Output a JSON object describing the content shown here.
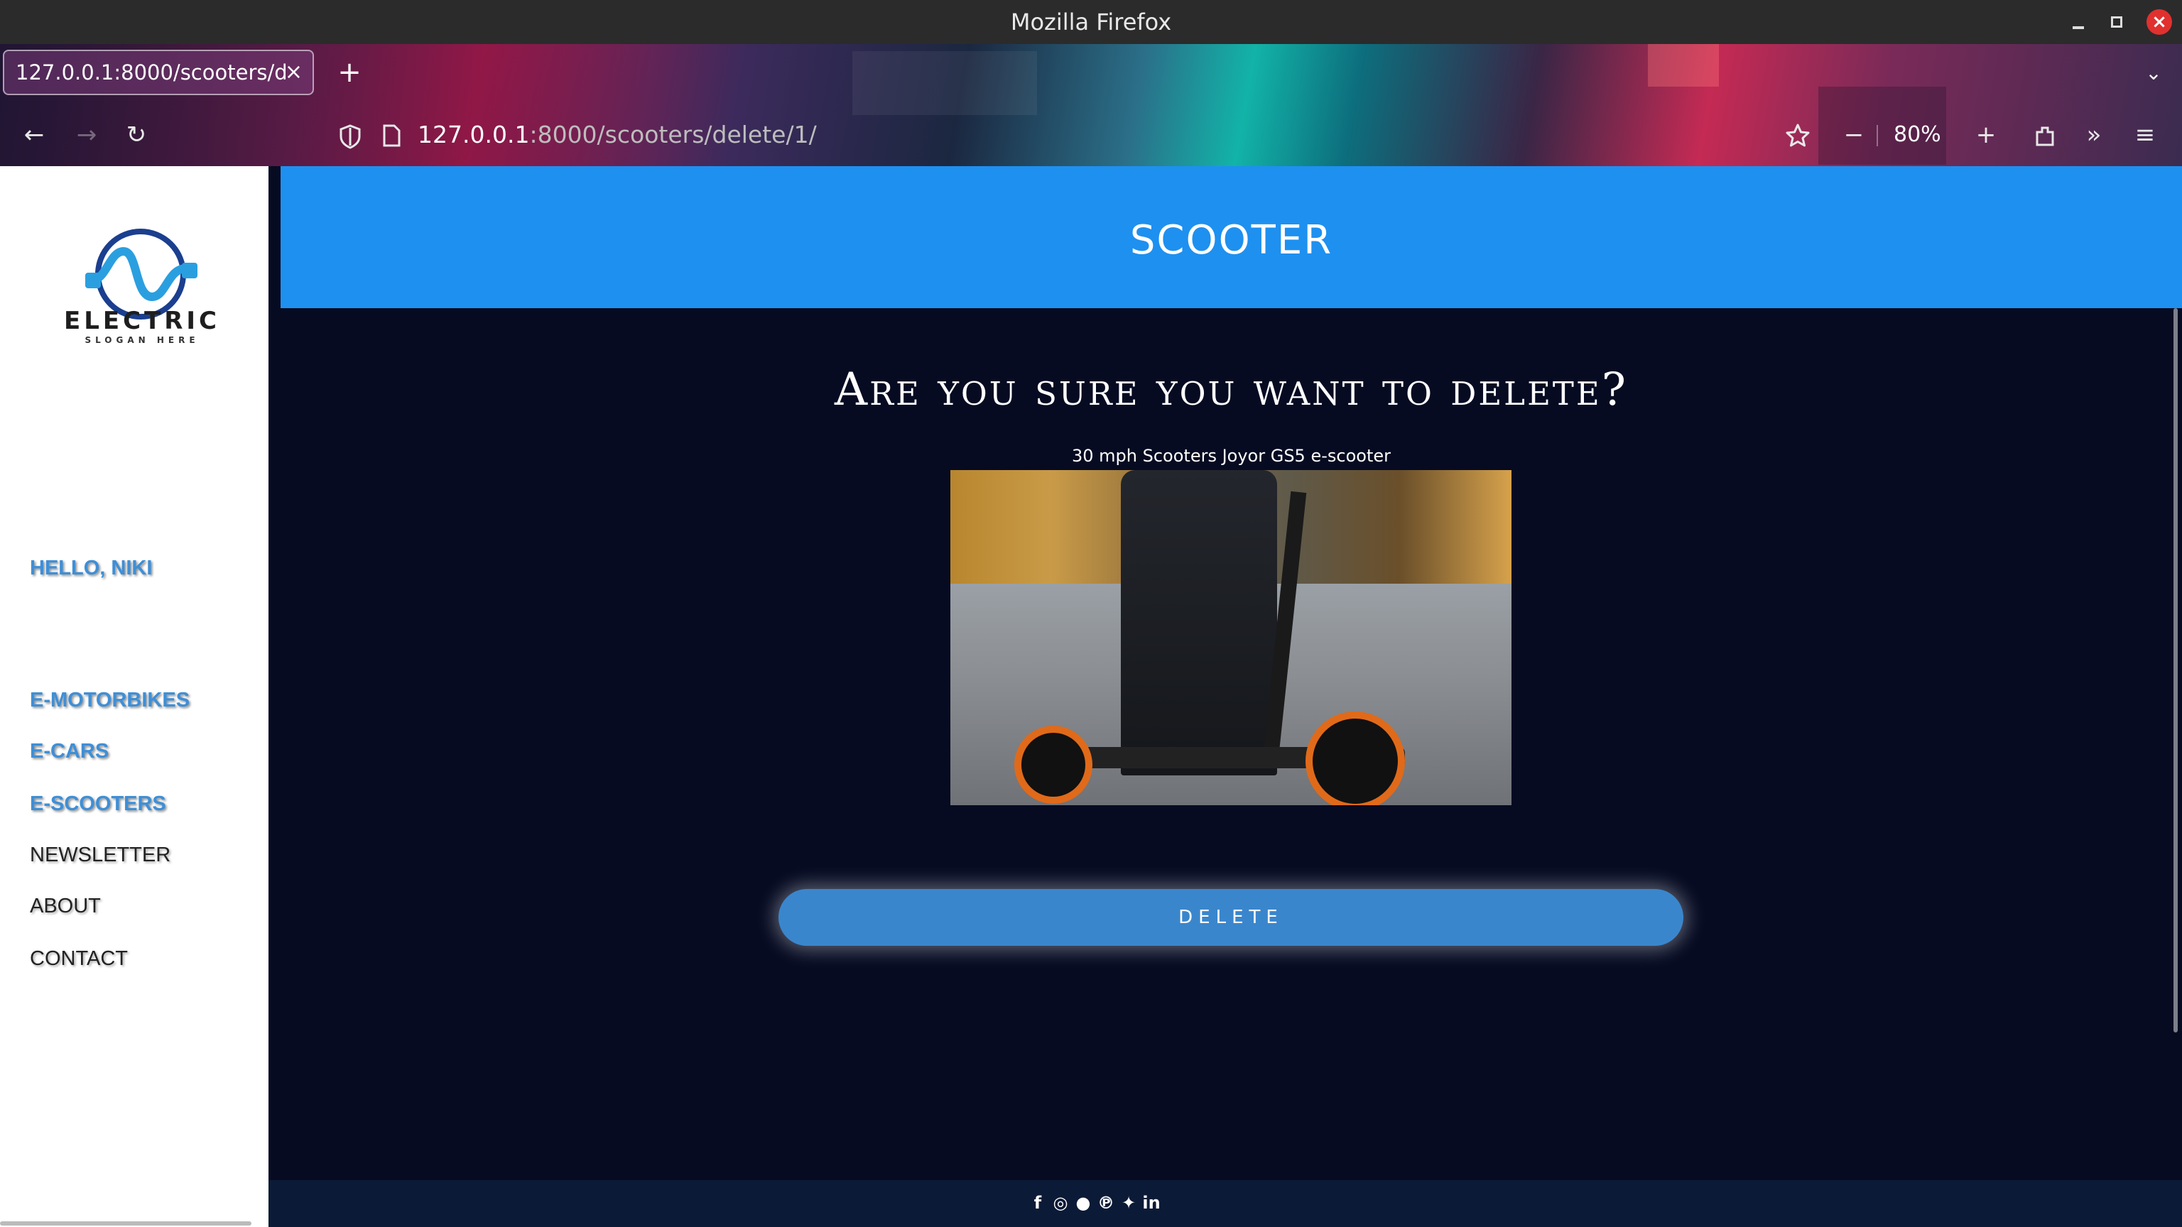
{
  "window": {
    "title": "Mozilla Firefox"
  },
  "tab": {
    "title": "127.0.0.1:8000/scooters/d",
    "close": "×"
  },
  "newtab": "+",
  "navbar": {
    "url_host": "127.0.0.1",
    "url_path": ":8000/scooters/delete/1/",
    "zoom": "80%",
    "zoom_minus": "−",
    "zoom_plus": "+"
  },
  "sidebar": {
    "logo_text": "ELECTRIC",
    "logo_sub": "SLOGAN HERE",
    "greeting": "HELLO, NIKI",
    "links": [
      "E-MOTORBIKES",
      "E-CARS",
      "E-SCOOTERS",
      "NEWSLETTER",
      "ABOUT",
      "CONTACT"
    ]
  },
  "header": {
    "title": "SCOOTER"
  },
  "main": {
    "question": "Are you sure you want to delete?",
    "caption": "30 mph Scooters Joyor GS5 e-scooter",
    "delete_label": "DELETE"
  },
  "footer": {
    "social": [
      "facebook-icon",
      "instagram-icon",
      "snapchat-icon",
      "pinterest-icon",
      "twitter-icon",
      "linkedin-icon"
    ]
  },
  "colors": {
    "header": "#1e90f0",
    "page_bg": "#060b22",
    "button": "#3a86cc",
    "link_blue": "#3d8fd8"
  }
}
